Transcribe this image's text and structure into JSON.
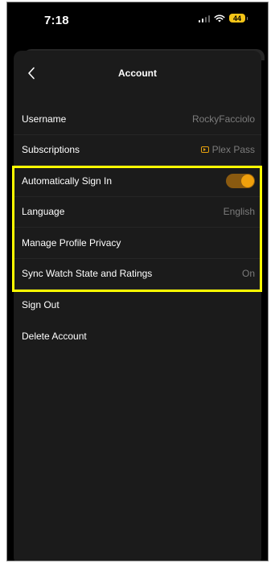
{
  "status_bar": {
    "time": "7:18",
    "battery": "44"
  },
  "screen": {
    "title": "Account",
    "rows": [
      {
        "label": "Username",
        "value": "RockyFacciolo"
      },
      {
        "label": "Subscriptions",
        "value": "Plex Pass"
      },
      {
        "label": "Automatically Sign In",
        "toggle_on": true
      },
      {
        "label": "Language",
        "value": "English"
      },
      {
        "label": "Manage Profile Privacy"
      },
      {
        "label": "Sync Watch State and Ratings",
        "value": "On"
      },
      {
        "label": "Sign Out"
      },
      {
        "label": "Delete Account"
      }
    ]
  },
  "colors": {
    "accent": "#e5a00d",
    "highlight": "#ffff00",
    "background": "#000000",
    "sheet": "#1b1b1b"
  }
}
